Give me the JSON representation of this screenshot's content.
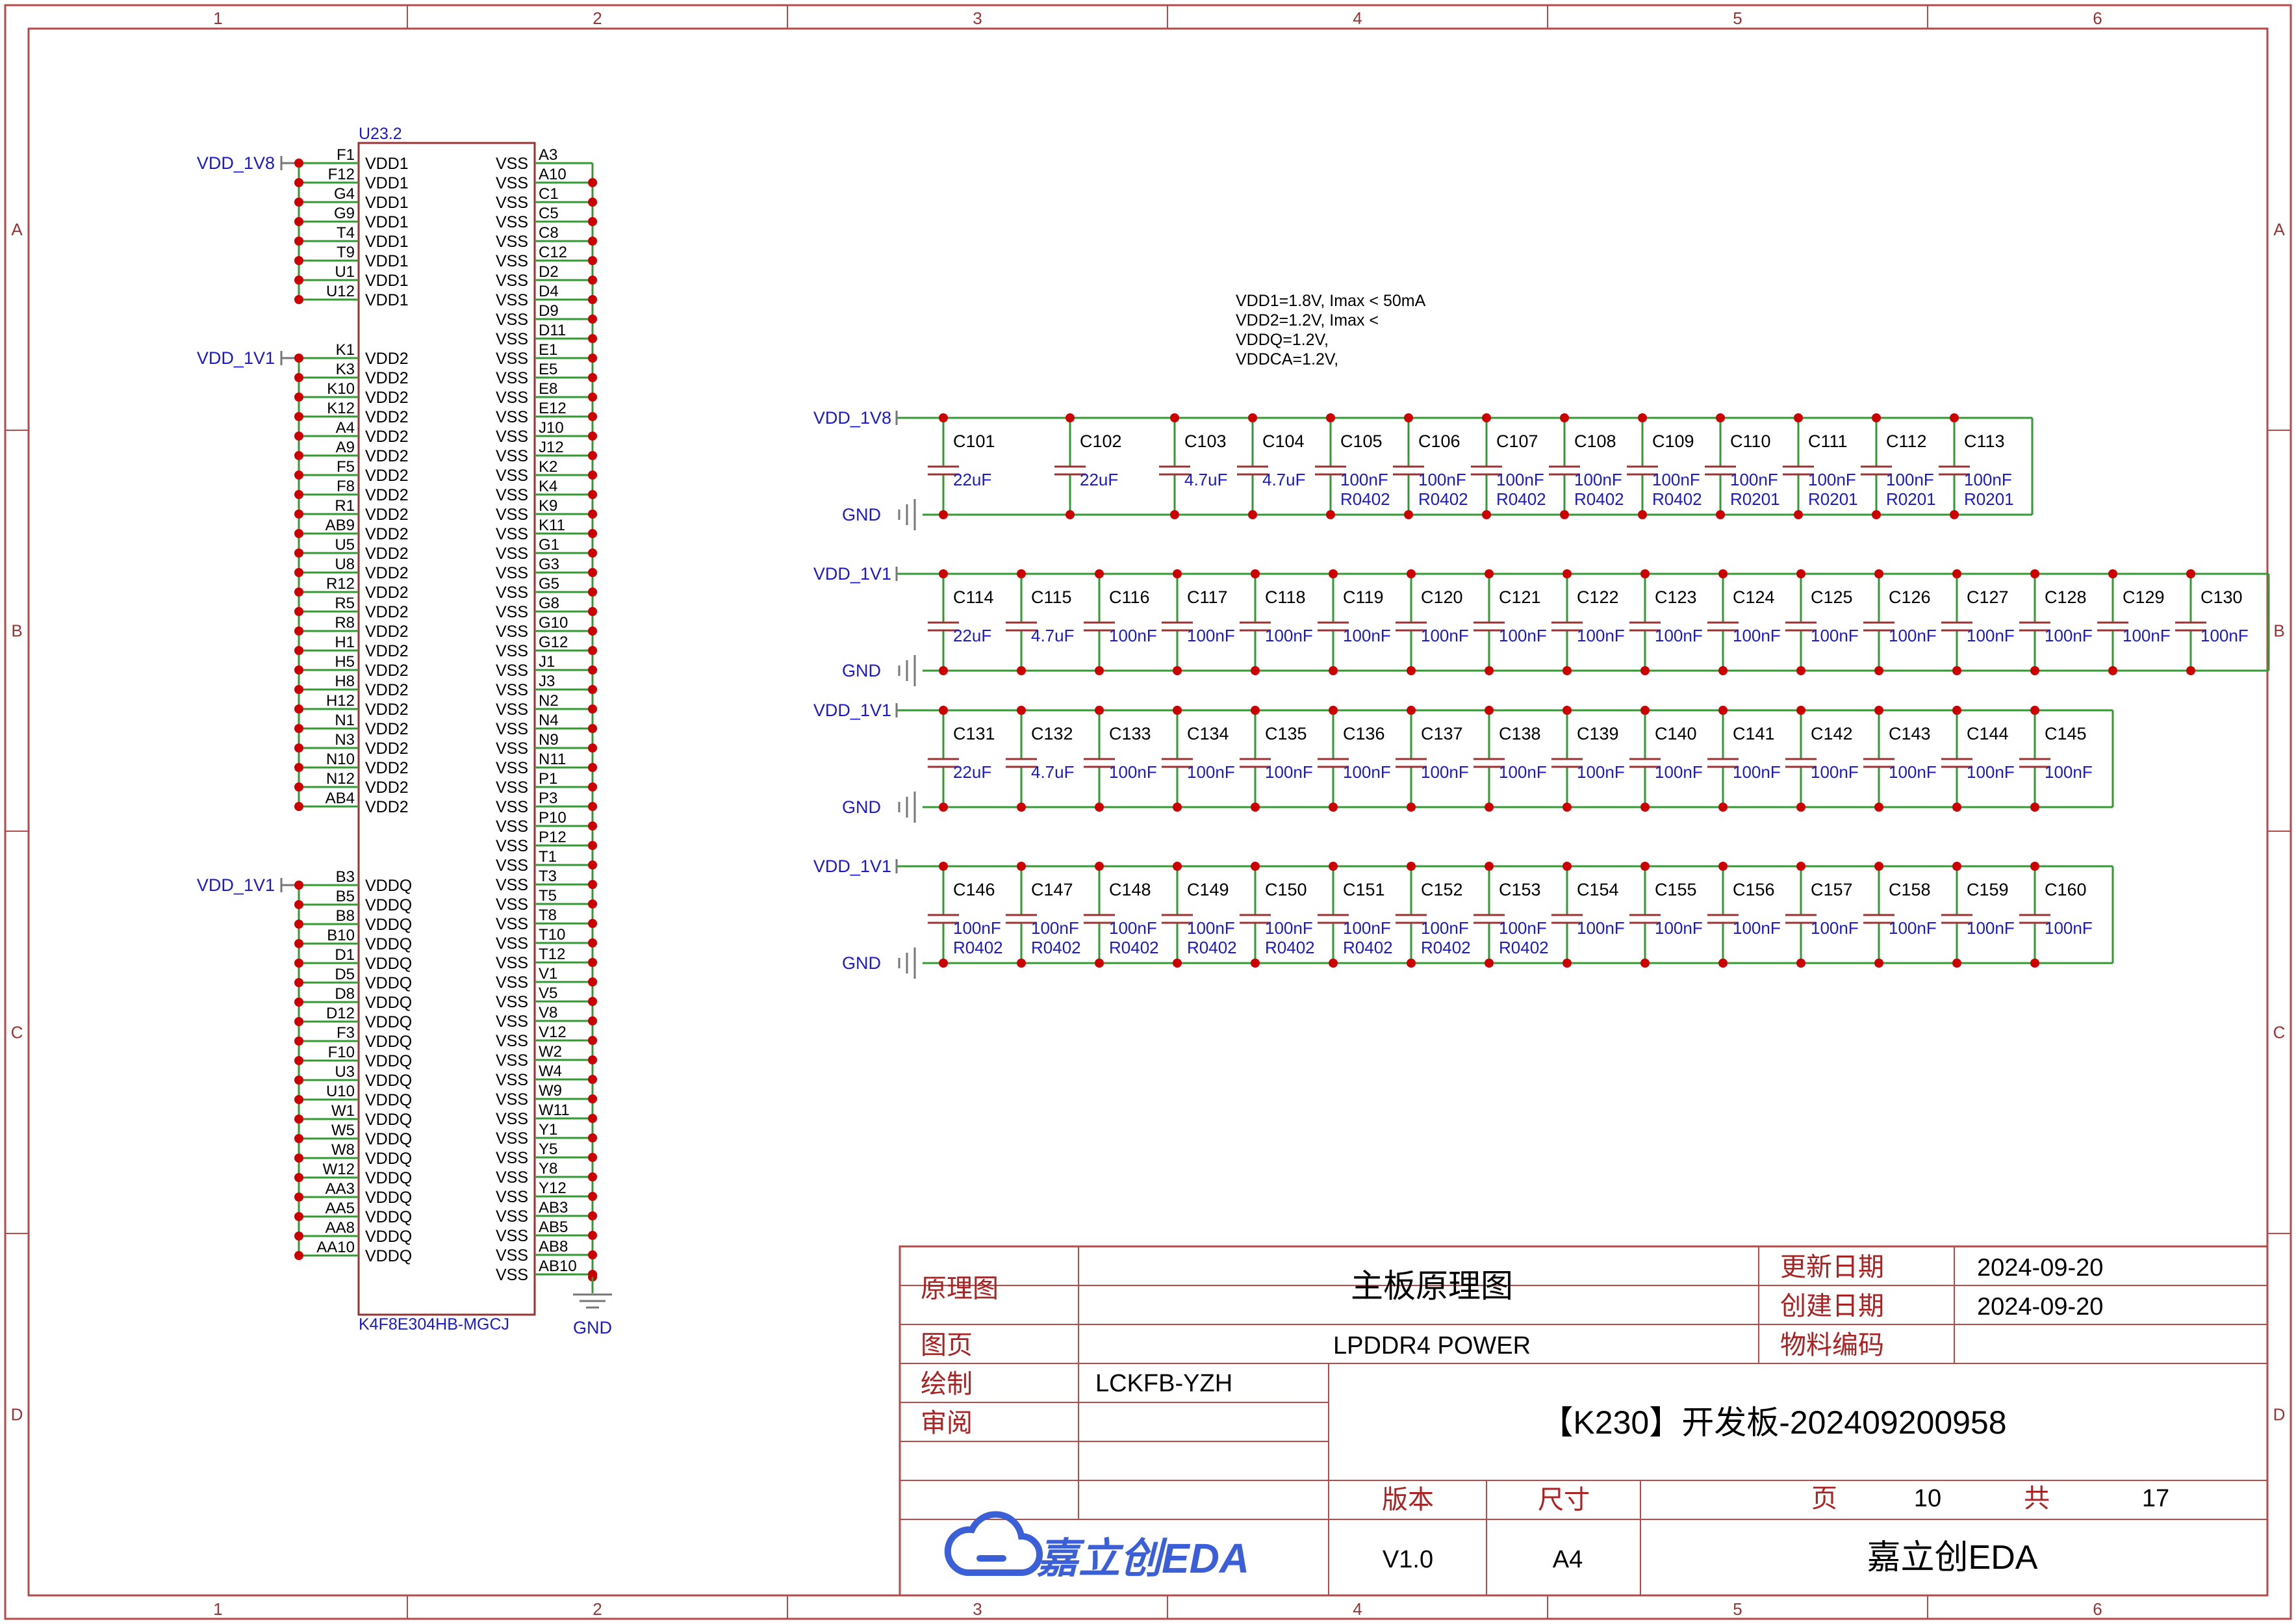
{
  "colors": {
    "border": "#b54a4a",
    "body": "#993333",
    "wire": "#339933",
    "net": "#1a1acc",
    "dot": "#cc0000",
    "text": "#000000",
    "title": "#aa2222",
    "logo": "#3b5fd6"
  },
  "frame": {
    "columns": [
      "1",
      "2",
      "3",
      "4",
      "5",
      "6"
    ],
    "rows": [
      "A",
      "B",
      "C",
      "D"
    ]
  },
  "chip": {
    "designator": "U23.2",
    "part": "K4F8E304HB-MGCJ",
    "gnd": "GND",
    "vdd1": {
      "net": "VDD_1V8",
      "pin_name": "VDD1",
      "pins": [
        "F1",
        "F12",
        "G4",
        "G9",
        "T4",
        "T9",
        "U1",
        "U12"
      ]
    },
    "vdd2": {
      "net": "VDD_1V1",
      "pin_name": "VDD2",
      "pins": [
        "K1",
        "K3",
        "K10",
        "K12",
        "A4",
        "A9",
        "F5",
        "F8",
        "R1",
        "AB9",
        "U5",
        "U8",
        "R12",
        "R5",
        "R8",
        "H1",
        "H5",
        "H8",
        "H12",
        "N1",
        "N3",
        "N10",
        "N12",
        "AB4"
      ]
    },
    "vddq": {
      "net": "VDD_1V1",
      "pin_name": "VDDQ",
      "pins": [
        "B3",
        "B5",
        "B8",
        "B10",
        "D1",
        "D5",
        "D8",
        "D12",
        "F3",
        "F10",
        "U3",
        "U10",
        "W1",
        "W5",
        "W8",
        "W12",
        "AA3",
        "AA5",
        "AA8",
        "AA10"
      ]
    },
    "vss": {
      "pin_name": "VSS",
      "pins": [
        "A3",
        "A10",
        "C1",
        "C5",
        "C8",
        "C12",
        "D2",
        "D4",
        "D9",
        "D11",
        "E1",
        "E5",
        "E8",
        "E12",
        "J10",
        "J12",
        "K2",
        "K4",
        "K9",
        "K11",
        "G1",
        "G3",
        "G5",
        "G8",
        "G10",
        "G12",
        "J1",
        "J3",
        "N2",
        "N4",
        "N9",
        "N11",
        "P1",
        "P3",
        "P10",
        "P12",
        "T1",
        "T3",
        "T5",
        "T8",
        "T10",
        "T12",
        "V1",
        "V5",
        "V8",
        "V12",
        "W2",
        "W4",
        "W9",
        "W11",
        "Y1",
        "Y5",
        "Y8",
        "Y12",
        "AB3",
        "AB5",
        "AB8",
        "AB10"
      ]
    }
  },
  "notes": [
    "VDD1=1.8V, Imax < 50mA",
    "VDD2=1.2V, Imax <",
    "VDDQ=1.2V,",
    "VDDCA=1.2V,"
  ],
  "cap_rows": [
    {
      "net": "VDD_1V8",
      "gnd": "GND",
      "caps": [
        {
          "ref": "C101",
          "val": "22uF",
          "pkg": ""
        },
        {
          "ref": "C102",
          "val": "22uF",
          "pkg": ""
        },
        {
          "ref": "C103",
          "val": "4.7uF",
          "pkg": ""
        },
        {
          "ref": "C104",
          "val": "4.7uF",
          "pkg": ""
        },
        {
          "ref": "C105",
          "val": "100nF",
          "pkg": "R0402"
        },
        {
          "ref": "C106",
          "val": "100nF",
          "pkg": "R0402"
        },
        {
          "ref": "C107",
          "val": "100nF",
          "pkg": "R0402"
        },
        {
          "ref": "C108",
          "val": "100nF",
          "pkg": "R0402"
        },
        {
          "ref": "C109",
          "val": "100nF",
          "pkg": "R0402"
        },
        {
          "ref": "C110",
          "val": "100nF",
          "pkg": "R0201"
        },
        {
          "ref": "C111",
          "val": "100nF",
          "pkg": "R0201"
        },
        {
          "ref": "C112",
          "val": "100nF",
          "pkg": "R0201"
        },
        {
          "ref": "C113",
          "val": "100nF",
          "pkg": "R0201"
        }
      ]
    },
    {
      "net": "VDD_1V1",
      "gnd": "GND",
      "caps": [
        {
          "ref": "C114",
          "val": "22uF",
          "pkg": ""
        },
        {
          "ref": "C115",
          "val": "4.7uF",
          "pkg": ""
        },
        {
          "ref": "C116",
          "val": "100nF",
          "pkg": ""
        },
        {
          "ref": "C117",
          "val": "100nF",
          "pkg": ""
        },
        {
          "ref": "C118",
          "val": "100nF",
          "pkg": ""
        },
        {
          "ref": "C119",
          "val": "100nF",
          "pkg": ""
        },
        {
          "ref": "C120",
          "val": "100nF",
          "pkg": ""
        },
        {
          "ref": "C121",
          "val": "100nF",
          "pkg": ""
        },
        {
          "ref": "C122",
          "val": "100nF",
          "pkg": ""
        },
        {
          "ref": "C123",
          "val": "100nF",
          "pkg": ""
        },
        {
          "ref": "C124",
          "val": "100nF",
          "pkg": ""
        },
        {
          "ref": "C125",
          "val": "100nF",
          "pkg": ""
        },
        {
          "ref": "C126",
          "val": "100nF",
          "pkg": ""
        },
        {
          "ref": "C127",
          "val": "100nF",
          "pkg": ""
        },
        {
          "ref": "C128",
          "val": "100nF",
          "pkg": ""
        },
        {
          "ref": "C129",
          "val": "100nF",
          "pkg": ""
        },
        {
          "ref": "C130",
          "val": "100nF",
          "pkg": ""
        }
      ]
    },
    {
      "net": "VDD_1V1",
      "gnd": "GND",
      "caps": [
        {
          "ref": "C131",
          "val": "22uF",
          "pkg": ""
        },
        {
          "ref": "C132",
          "val": "4.7uF",
          "pkg": ""
        },
        {
          "ref": "C133",
          "val": "100nF",
          "pkg": ""
        },
        {
          "ref": "C134",
          "val": "100nF",
          "pkg": ""
        },
        {
          "ref": "C135",
          "val": "100nF",
          "pkg": ""
        },
        {
          "ref": "C136",
          "val": "100nF",
          "pkg": ""
        },
        {
          "ref": "C137",
          "val": "100nF",
          "pkg": ""
        },
        {
          "ref": "C138",
          "val": "100nF",
          "pkg": ""
        },
        {
          "ref": "C139",
          "val": "100nF",
          "pkg": ""
        },
        {
          "ref": "C140",
          "val": "100nF",
          "pkg": ""
        },
        {
          "ref": "C141",
          "val": "100nF",
          "pkg": ""
        },
        {
          "ref": "C142",
          "val": "100nF",
          "pkg": ""
        },
        {
          "ref": "C143",
          "val": "100nF",
          "pkg": ""
        },
        {
          "ref": "C144",
          "val": "100nF",
          "pkg": ""
        },
        {
          "ref": "C145",
          "val": "100nF",
          "pkg": ""
        }
      ]
    },
    {
      "net": "VDD_1V1",
      "gnd": "GND",
      "caps": [
        {
          "ref": "C146",
          "val": "100nF",
          "pkg": "R0402"
        },
        {
          "ref": "C147",
          "val": "100nF",
          "pkg": "R0402"
        },
        {
          "ref": "C148",
          "val": "100nF",
          "pkg": "R0402"
        },
        {
          "ref": "C149",
          "val": "100nF",
          "pkg": "R0402"
        },
        {
          "ref": "C150",
          "val": "100nF",
          "pkg": "R0402"
        },
        {
          "ref": "C151",
          "val": "100nF",
          "pkg": "R0402"
        },
        {
          "ref": "C152",
          "val": "100nF",
          "pkg": "R0402"
        },
        {
          "ref": "C153",
          "val": "100nF",
          "pkg": "R0402"
        },
        {
          "ref": "C154",
          "val": "100nF",
          "pkg": ""
        },
        {
          "ref": "C155",
          "val": "100nF",
          "pkg": ""
        },
        {
          "ref": "C156",
          "val": "100nF",
          "pkg": ""
        },
        {
          "ref": "C157",
          "val": "100nF",
          "pkg": ""
        },
        {
          "ref": "C158",
          "val": "100nF",
          "pkg": ""
        },
        {
          "ref": "C159",
          "val": "100nF",
          "pkg": ""
        },
        {
          "ref": "C160",
          "val": "100nF",
          "pkg": ""
        }
      ]
    }
  ],
  "title_block": {
    "label_schematic": "原理图",
    "title": "主板原理图",
    "label_updated": "更新日期",
    "updated": "2024-09-20",
    "label_created": "创建日期",
    "created": "2024-09-20",
    "label_page": "图页",
    "page_name": "LPDDR4 POWER",
    "label_part": "物料编码",
    "part_code": "",
    "label_drawn": "绘制",
    "drawn": "LCKFB-YZH",
    "label_review": "审阅",
    "review": "",
    "project": "【K230】开发板-202409200958",
    "label_version": "版本",
    "version": "V1.0",
    "label_size": "尺寸",
    "size": "A4",
    "label_pg": "页",
    "page_no": "10",
    "label_total": "共",
    "total": "17",
    "logo": "嘉立创EDA",
    "company": "嘉立创EDA"
  }
}
